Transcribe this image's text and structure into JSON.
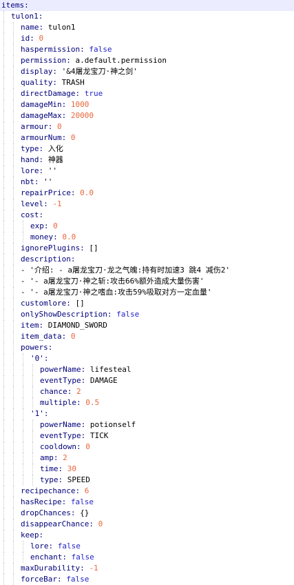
{
  "editor": {
    "language": "yaml",
    "colors": {
      "key": "#00007a",
      "text_value": "#000000",
      "number_value": "#e8663a",
      "boolean_value": "#1f1fc8",
      "current_line_highlight": "#ececff",
      "indent_guide": "#c8c8c8"
    },
    "lines": [
      {
        "indent": 0,
        "key": "items",
        "current": true
      },
      {
        "indent": 1,
        "key": "tulon1"
      },
      {
        "indent": 2,
        "key": "name",
        "value": "tulon1",
        "vtype": "text"
      },
      {
        "indent": 2,
        "key": "id",
        "value": "0",
        "vtype": "number"
      },
      {
        "indent": 2,
        "key": "haspermission",
        "value": "false",
        "vtype": "bool"
      },
      {
        "indent": 2,
        "key": "permission",
        "value": "a.default.permission",
        "vtype": "text"
      },
      {
        "indent": 2,
        "key": "display",
        "value": "'&4屠龙宝刀·神之剑'",
        "vtype": "text"
      },
      {
        "indent": 2,
        "key": "quality",
        "value": "TRASH",
        "vtype": "text"
      },
      {
        "indent": 2,
        "key": "directDamage",
        "value": "true",
        "vtype": "bool"
      },
      {
        "indent": 2,
        "key": "damageMin",
        "value": "1000",
        "vtype": "number"
      },
      {
        "indent": 2,
        "key": "damageMax",
        "value": "20000",
        "vtype": "number"
      },
      {
        "indent": 2,
        "key": "armour",
        "value": "0",
        "vtype": "number"
      },
      {
        "indent": 2,
        "key": "armourNum",
        "value": "0",
        "vtype": "number"
      },
      {
        "indent": 2,
        "key": "type",
        "value": "入化",
        "vtype": "text"
      },
      {
        "indent": 2,
        "key": "hand",
        "value": "神器",
        "vtype": "text"
      },
      {
        "indent": 2,
        "key": "lore",
        "value": "''",
        "vtype": "text"
      },
      {
        "indent": 2,
        "key": "nbt",
        "value": "''",
        "vtype": "text"
      },
      {
        "indent": 2,
        "key": "repairPrice",
        "value": "0.0",
        "vtype": "number"
      },
      {
        "indent": 2,
        "key": "level",
        "value": "-1",
        "vtype": "number"
      },
      {
        "indent": 2,
        "key": "cost"
      },
      {
        "indent": 3,
        "key": "exp",
        "value": "0",
        "vtype": "number"
      },
      {
        "indent": 3,
        "key": "money",
        "value": "0.0",
        "vtype": "number"
      },
      {
        "indent": 2,
        "key": "ignorePlugins",
        "value": "[]",
        "vtype": "text"
      },
      {
        "indent": 2,
        "key": "description"
      },
      {
        "indent": 2,
        "item": "- '介绍: - a屠龙宝刀·龙之气魄:持有时加速3 跳4 减伤2'"
      },
      {
        "indent": 2,
        "item": "- '- a屠龙宝刀·神之斩:攻击66%额外造成大量伤害'"
      },
      {
        "indent": 2,
        "item": "- '- a屠龙宝刀·神之嗜血:攻击59%吸取对方一定血量'"
      },
      {
        "indent": 2,
        "key": "customlore",
        "value": "[]",
        "vtype": "text"
      },
      {
        "indent": 2,
        "key": "onlyShowDescription",
        "value": "false",
        "vtype": "bool"
      },
      {
        "indent": 2,
        "key": "item",
        "value": "DIAMOND_SWORD",
        "vtype": "text"
      },
      {
        "indent": 2,
        "key": "item_data",
        "value": "0",
        "vtype": "number"
      },
      {
        "indent": 2,
        "key": "powers"
      },
      {
        "indent": 3,
        "key": "'0'"
      },
      {
        "indent": 4,
        "key": "powerName",
        "value": "lifesteal",
        "vtype": "text"
      },
      {
        "indent": 4,
        "key": "eventType",
        "value": "DAMAGE",
        "vtype": "text"
      },
      {
        "indent": 4,
        "key": "chance",
        "value": "2",
        "vtype": "number"
      },
      {
        "indent": 4,
        "key": "multiple",
        "value": "0.5",
        "vtype": "number"
      },
      {
        "indent": 3,
        "key": "'1'"
      },
      {
        "indent": 4,
        "key": "powerName",
        "value": "potionself",
        "vtype": "text"
      },
      {
        "indent": 4,
        "key": "eventType",
        "value": "TICK",
        "vtype": "text"
      },
      {
        "indent": 4,
        "key": "cooldown",
        "value": "0",
        "vtype": "number"
      },
      {
        "indent": 4,
        "key": "amp",
        "value": "2",
        "vtype": "number"
      },
      {
        "indent": 4,
        "key": "time",
        "value": "30",
        "vtype": "number"
      },
      {
        "indent": 4,
        "key": "type",
        "value": "SPEED",
        "vtype": "text"
      },
      {
        "indent": 2,
        "key": "recipechance",
        "value": "6",
        "vtype": "number"
      },
      {
        "indent": 2,
        "key": "hasRecipe",
        "value": "false",
        "vtype": "bool"
      },
      {
        "indent": 2,
        "key": "dropChances",
        "value": "{}",
        "vtype": "text"
      },
      {
        "indent": 2,
        "key": "disappearChance",
        "value": "0",
        "vtype": "number"
      },
      {
        "indent": 2,
        "key": "keep"
      },
      {
        "indent": 3,
        "key": "lore",
        "value": "false",
        "vtype": "bool"
      },
      {
        "indent": 3,
        "key": "enchant",
        "value": "false",
        "vtype": "bool"
      },
      {
        "indent": 2,
        "key": "maxDurability",
        "value": "-1",
        "vtype": "number"
      },
      {
        "indent": 2,
        "key": "forceBar",
        "value": "false",
        "vtype": "bool"
      }
    ]
  }
}
